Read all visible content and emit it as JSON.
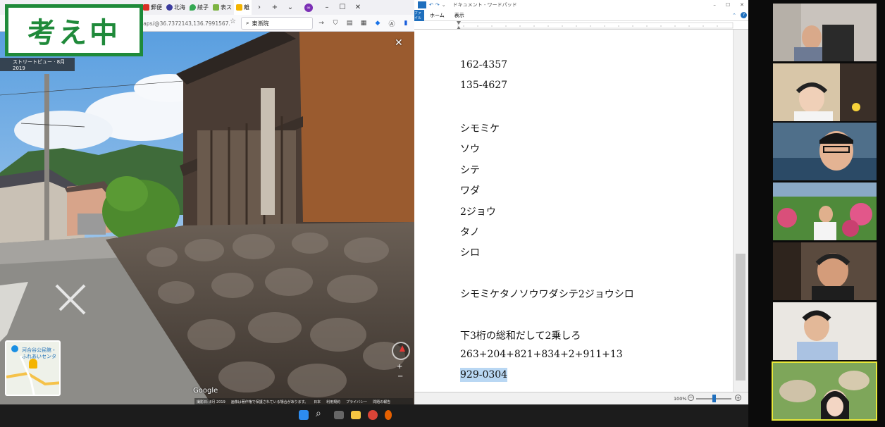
{
  "overlay": {
    "thinking_label": "考え中"
  },
  "browser": {
    "tabs": [
      {
        "label": "郵便",
        "color": "#d93025"
      },
      {
        "label": "北海",
        "color": "#3b3b9e"
      },
      {
        "label": "綾子",
        "color": "#34a853"
      },
      {
        "label": "表ス",
        "color": "#7cb342"
      },
      {
        "label": "離",
        "color": "#f4b400"
      }
    ],
    "url": "maps/@36.7372143,136.7991567...",
    "search_value": "東漸院",
    "streetview_label": "ストリートビュー · 8月 2019",
    "minimap_label": "河合谷公民館・ふれあいセンタ",
    "google_logo": "Google",
    "footer_items": [
      "撮影日: 8月 2019",
      "画像は著作権で保護されている場合があります。",
      "日本",
      "利用規約",
      "プライバシー",
      "問題の報告"
    ]
  },
  "wordpad": {
    "title": "ドキュメント - ワードパッド",
    "ribbon_tabs": [
      "ファイル",
      "ホーム",
      "表示"
    ],
    "lines": [
      "162-4357",
      "135-4627",
      "",
      "シモミケ",
      "ソウ",
      "シテ",
      "ワダ",
      "2ジョウ",
      "タノ",
      "シロ",
      "",
      "シモミケタノソウワダシテ2ジョウシロ",
      "",
      "下3桁の総和だして2乗しろ",
      "263+204+821+834+2+911+13",
      "929-0304"
    ],
    "selected_line": "929-0304",
    "zoom": "100%"
  },
  "colors": {
    "accent_green": "#1f8a3a",
    "highlight": "#b9d7f3",
    "active_speaker": "#e8e83a"
  }
}
